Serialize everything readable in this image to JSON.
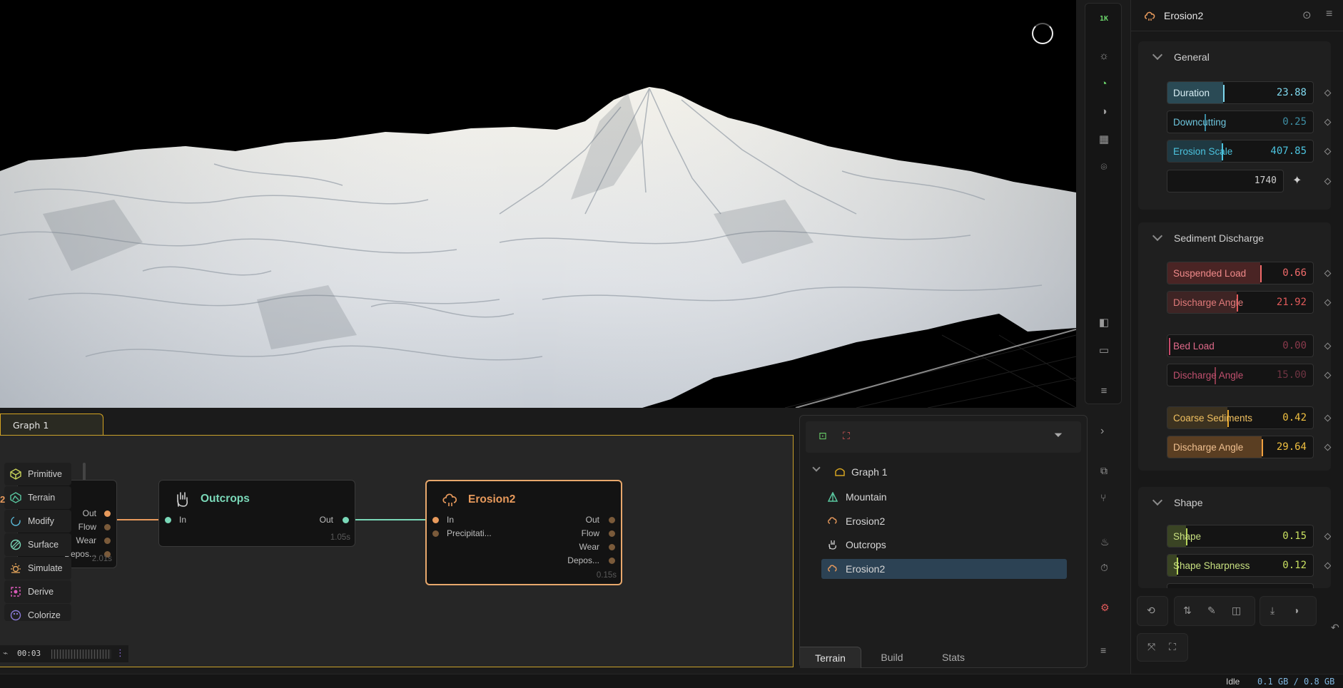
{
  "viewport": {
    "resolution_label": "1K"
  },
  "props": {
    "node_title": "Erosion2",
    "sections": {
      "general": {
        "title": "General",
        "duration": {
          "label": "Duration",
          "value": "23.88"
        },
        "downcutting": {
          "label": "Downcutting",
          "value": "0.25"
        },
        "erosion_scale": {
          "label": "Erosion Scale",
          "value": "407.85"
        },
        "seed": {
          "value": "1740"
        }
      },
      "sediment": {
        "title": "Sediment Discharge",
        "suspended_load": {
          "label": "Suspended Load",
          "value": "0.66"
        },
        "discharge_angle_1": {
          "label": "Discharge Angle",
          "value": "21.92"
        },
        "bed_load": {
          "label": "Bed Load",
          "value": "0.00"
        },
        "discharge_angle_2": {
          "label": "Discharge Angle",
          "value": "15.00"
        },
        "coarse_sediments": {
          "label": "Coarse Sediments",
          "value": "0.42"
        },
        "discharge_angle_3": {
          "label": "Discharge Angle",
          "value": "29.64"
        }
      },
      "shape": {
        "title": "Shape",
        "shape": {
          "label": "Shape",
          "value": "0.15"
        },
        "shape_sharpness": {
          "label": "Shape Sharpness",
          "value": "0.12"
        }
      }
    }
  },
  "graph": {
    "tab_label": "Graph 1",
    "palette": [
      "Primitive",
      "Terrain",
      "Modify",
      "Surface",
      "Simulate",
      "Derive",
      "Colorize"
    ],
    "partial_node": {
      "ports_out": [
        "Out",
        "Flow",
        "Wear",
        "Depos..."
      ],
      "time": "2.01s"
    },
    "outcrops_node": {
      "title": "Outcrops",
      "in": "In",
      "out": "Out",
      "time": "1.05s"
    },
    "erosion_node": {
      "title": "Erosion2",
      "in": "In",
      "in2": "Precipitati...",
      "ports_out": [
        "Out",
        "Flow",
        "Wear",
        "Depos..."
      ],
      "time": "0.15s"
    },
    "timer": "00:03",
    "left_marker": "2"
  },
  "tree": {
    "root": "Graph 1",
    "items": [
      "Mountain",
      "Erosion2",
      "Outcrops",
      "Erosion2"
    ],
    "tabs": [
      "Terrain",
      "Build",
      "Stats"
    ]
  },
  "status": {
    "state": "Idle",
    "memory": "0.1 GB / 0.8 GB"
  },
  "colors": {
    "accent_gold": "#c9a12a",
    "erosion_orange": "#e89a5c",
    "outcrops_teal": "#7ad8b8",
    "general_blue": "#4cc3de",
    "sediment_red": "#e05a5a",
    "coarse_orange": "#e8a830",
    "shape_green": "#b7d35a"
  }
}
